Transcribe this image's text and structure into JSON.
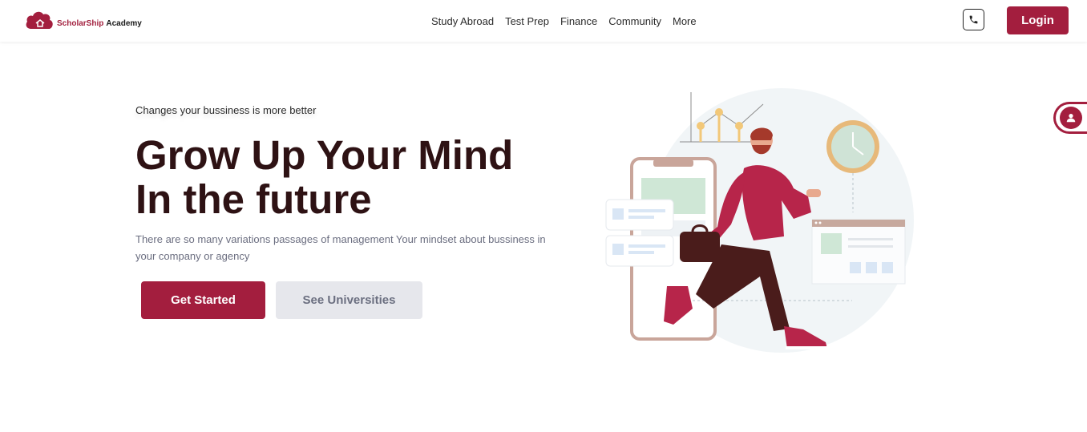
{
  "header": {
    "logo": {
      "brand": "ScholarShip",
      "suffix": "Academy"
    },
    "nav": [
      "Study Abroad",
      "Test Prep",
      "Finance",
      "Community",
      "More"
    ],
    "phone_icon": "phone-icon",
    "login_label": "Login"
  },
  "side_tab": {
    "icon": "user-icon"
  },
  "hero": {
    "tagline": "Changes your bussiness is more better",
    "headline_line1": "Grow Up Your Mind",
    "headline_line2": "In the future",
    "description": "There are so many variations passages of management Your mindset about bussiness in your company or agency",
    "primary_button": "Get Started",
    "secondary_button": "See Universities"
  },
  "colors": {
    "brand": "#a31e3e",
    "heading": "#2e1214",
    "muted_text": "#6b6e80",
    "secondary_button_bg": "#e6e7ec"
  }
}
